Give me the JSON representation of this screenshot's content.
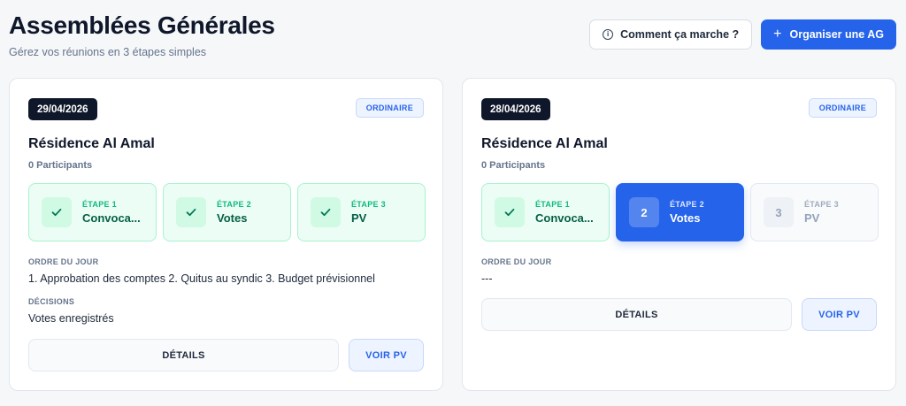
{
  "header": {
    "title": "Assemblées Générales",
    "subtitle": "Gérez vos réunions en 3 étapes simples",
    "help_label": "Comment ça marche ?",
    "help_icon": "info-icon",
    "create_label": "Organiser une AG",
    "create_icon": "plus-icon"
  },
  "colors": {
    "primary": "#2563eb",
    "success": "#10b981",
    "dark": "#0f172a"
  },
  "meetings": [
    {
      "date": "29/04/2026",
      "type": "ORDINAIRE",
      "residence": "Résidence Al Amal",
      "participants": "0 Participants",
      "steps": [
        {
          "eyebrow": "ÉTAPE 1",
          "name": "Convoca...",
          "state": "done",
          "icon": "check-icon"
        },
        {
          "eyebrow": "ÉTAPE 2",
          "name": "Votes",
          "state": "done",
          "icon": "check-icon"
        },
        {
          "eyebrow": "ÉTAPE 3",
          "name": "PV",
          "state": "done",
          "icon": "check-icon"
        }
      ],
      "agenda_label": "ORDRE DU JOUR",
      "agenda": "1. Approbation des comptes 2. Quitus au syndic 3. Budget prévisionnel",
      "decisions_label": "DÉCISIONS",
      "decisions": "Votes enregistrés",
      "details_label": "DÉTAILS",
      "pv_label": "VOIR PV"
    },
    {
      "date": "28/04/2026",
      "type": "ORDINAIRE",
      "residence": "Résidence Al Amal",
      "participants": "0 Participants",
      "steps": [
        {
          "eyebrow": "ÉTAPE 1",
          "name": "Convoca...",
          "state": "done",
          "icon": "check-icon"
        },
        {
          "eyebrow": "ÉTAPE 2",
          "name": "Votes",
          "state": "active",
          "number": "2"
        },
        {
          "eyebrow": "ÉTAPE 3",
          "name": "PV",
          "state": "pending",
          "number": "3"
        }
      ],
      "agenda_label": "ORDRE DU JOUR",
      "agenda": "---",
      "details_label": "DÉTAILS",
      "pv_label": "VOIR PV"
    }
  ]
}
